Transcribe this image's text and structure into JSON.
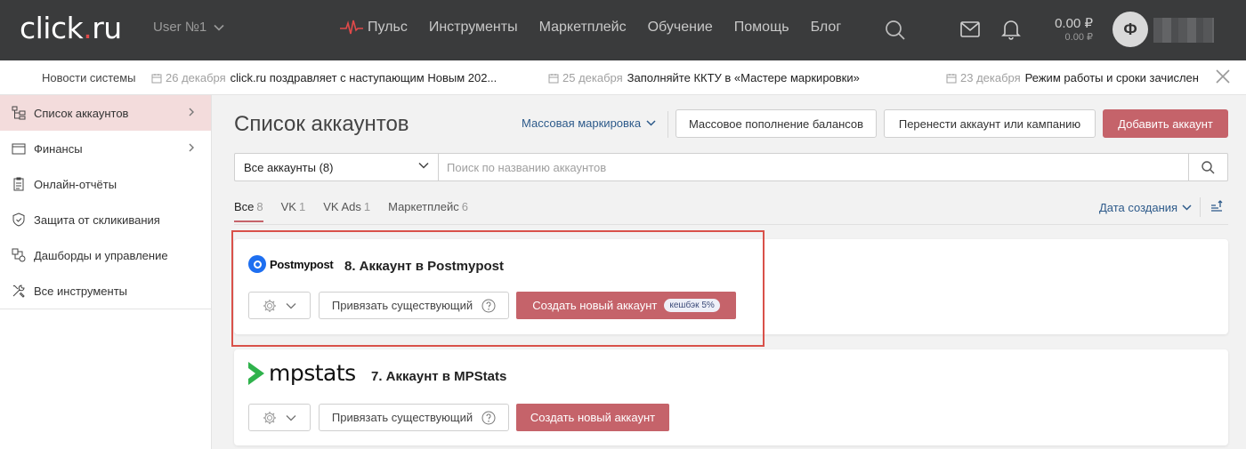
{
  "header": {
    "logo": {
      "prefix": "click",
      "dot": ".",
      "suffix": "ru"
    },
    "user": "User №1",
    "nav": [
      {
        "label": "Пульс",
        "icon": "pulse-icon"
      },
      {
        "label": "Инструменты"
      },
      {
        "label": "Маркетплейс"
      },
      {
        "label": "Обучение"
      },
      {
        "label": "Помощь"
      },
      {
        "label": "Блог"
      }
    ],
    "balance_main": "0.00 ₽",
    "balance_sub": "0.00 ₽",
    "avatar_letter": "Ф",
    "accent": "#e04a4a"
  },
  "news": {
    "title": "Новости системы",
    "items": [
      {
        "date": "26 декабря",
        "text": "click.ru поздравляет с наступающим Новым 202..."
      },
      {
        "date": "25 декабря",
        "text": "Заполняйте ККТУ в «Мастере маркировки»"
      },
      {
        "date": "23 декабря",
        "text": "Режим работы и сроки зачислен"
      }
    ]
  },
  "sidebar": {
    "items": [
      {
        "label": "Список аккаунтов",
        "icon": "accounts-tree-icon",
        "active": true
      },
      {
        "label": "Финансы",
        "icon": "wallet-icon"
      },
      {
        "label": "Онлайн-отчёты",
        "icon": "clipboard-icon"
      },
      {
        "label": "Защита от скликивания",
        "icon": "shield-icon"
      },
      {
        "label": "Дашборды и управление",
        "icon": "dashboard-icon"
      },
      {
        "label": "Все инструменты",
        "icon": "tools-icon"
      }
    ]
  },
  "main": {
    "title": "Список аккаунтов",
    "mass_marking": "Массовая маркировка",
    "mass_topup": "Массовое пополнение балансов",
    "transfer": "Перенести аккаунт или кампанию",
    "add_account": "Добавить аккаунт",
    "filter_select": "Все аккаунты (8)",
    "search_placeholder": "Поиск по названию аккаунтов",
    "tabs": [
      {
        "label": "Все",
        "count": "8",
        "active": true
      },
      {
        "label": "VK",
        "count": "1"
      },
      {
        "label": "VK Ads",
        "count": "1"
      },
      {
        "label": "Маркетплейс",
        "count": "6"
      }
    ],
    "sort_label": "Дата создания",
    "primary_color": "#c5636a"
  },
  "cards": [
    {
      "logo_text": "Postmypost",
      "title": "8. Аккаунт в Postmypost",
      "link_label": "Привязать существующий",
      "create_label": "Создать новый аккаунт",
      "badge": "кешбэк 5%"
    },
    {
      "logo_text": "mpstats",
      "title": "7. Аккаунт в MPStats",
      "link_label": "Привязать существующий",
      "create_label": "Создать новый аккаунт"
    }
  ]
}
